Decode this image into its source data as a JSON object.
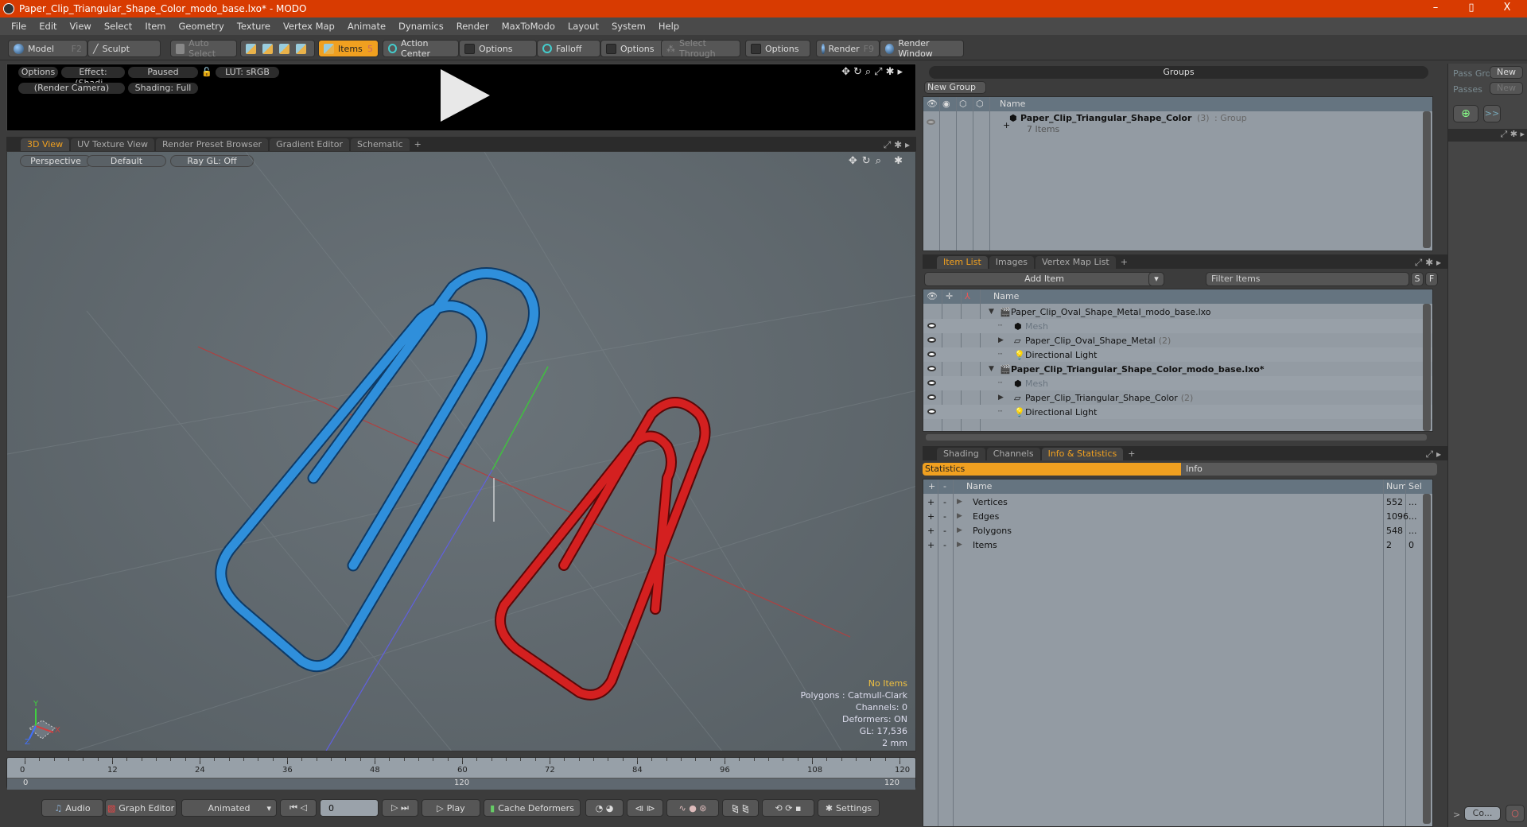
{
  "window": {
    "title": "Paper_Clip_Triangular_Shape_Color_modo_base.lxo* - MODO",
    "controls": [
      "–",
      "▯",
      "X"
    ]
  },
  "menu": [
    "File",
    "Edit",
    "View",
    "Select",
    "Item",
    "Geometry",
    "Texture",
    "Vertex Map",
    "Animate",
    "Dynamics",
    "Render",
    "MaxToModo",
    "Layout",
    "System",
    "Help"
  ],
  "toolbar": {
    "model": "Model",
    "model_key": "F2",
    "sculpt": "Sculpt",
    "auto_select": "Auto Select",
    "items": "Items",
    "items_key": "5",
    "action_center": "Action Center",
    "options1": "Options",
    "falloff": "Falloff",
    "options2": "Options",
    "select_through": "Select Through",
    "options3": "Options",
    "render": "Render",
    "render_key": "F9",
    "render_window": "Render Window"
  },
  "render_preview": {
    "options": "Options",
    "effect": "Effect: (Shadi...",
    "paused": "Paused",
    "lut": "LUT: sRGB",
    "camera": "(Render Camera)",
    "shading": "Shading: Full"
  },
  "view_tabs": [
    "3D View",
    "UV Texture View",
    "Render Preset Browser",
    "Gradient Editor",
    "Schematic",
    "+"
  ],
  "viewport": {
    "perspective": "Perspective",
    "default": "Default",
    "raygl": "Ray GL: Off",
    "axis_labels": {
      "x": "X",
      "y": "Y",
      "z": "Z"
    },
    "overlay": {
      "no_items": "No Items",
      "polygons": "Polygons : Catmull-Clark",
      "channels": "Channels: 0",
      "deformers": "Deformers: ON",
      "gl": "GL: 17,536",
      "scale": "2 mm"
    },
    "colors": {
      "blue_clip": "#2f8fdb",
      "red_clip": "#d42020",
      "accent": "#f0a020"
    }
  },
  "timeline": {
    "ticks": [
      "0",
      "12",
      "24",
      "36",
      "48",
      "60",
      "72",
      "84",
      "96",
      "108",
      "120"
    ],
    "range_start": "0",
    "range_mid": "120",
    "range_end": "120"
  },
  "bottombar": {
    "audio": "Audio",
    "graph_editor": "Graph Editor",
    "animated": "Animated",
    "frame": "0",
    "play": "Play",
    "cache": "Cache Deformers",
    "settings": "Settings"
  },
  "groups": {
    "title": "Groups",
    "new_group": "New Group",
    "col_name": "Name",
    "rows": [
      {
        "name": "Paper_Clip_Triangular_Shape_Color",
        "count": "(3)",
        "type": ": Group",
        "sub": "7 Items"
      }
    ]
  },
  "passes": {
    "pass_groups": "Pass Gro",
    "passes": "Passes",
    "new1": "New",
    "new2": "New",
    "forward": ">>"
  },
  "item_list": {
    "tabs": [
      "Item List",
      "Images",
      "Vertex Map List",
      "+"
    ],
    "add_item": "Add Item",
    "filter_placeholder": "Filter Items",
    "s": "S",
    "f": "F",
    "col_name": "Name",
    "rows": [
      {
        "label": "Paper_Clip_Oval_Shape_Metal_modo_base.lxo",
        "count": "",
        "level": 0,
        "bold": false,
        "dim": false,
        "eye": false
      },
      {
        "label": "Mesh",
        "count": "",
        "level": 1,
        "bold": false,
        "dim": true,
        "eye": true
      },
      {
        "label": "Paper_Clip_Oval_Shape_Metal",
        "count": "(2)",
        "level": 1,
        "bold": false,
        "dim": false,
        "eye": true
      },
      {
        "label": "Directional Light",
        "count": "",
        "level": 1,
        "bold": false,
        "dim": false,
        "eye": true
      },
      {
        "label": "Paper_Clip_Triangular_Shape_Color_modo_base.lxo*",
        "count": "",
        "level": 0,
        "bold": true,
        "dim": false,
        "eye": true
      },
      {
        "label": "Mesh",
        "count": "",
        "level": 1,
        "bold": false,
        "dim": true,
        "eye": true
      },
      {
        "label": "Paper_Clip_Triangular_Shape_Color",
        "count": "(2)",
        "level": 1,
        "bold": false,
        "dim": false,
        "eye": true
      },
      {
        "label": "Directional Light",
        "count": "",
        "level": 1,
        "bold": false,
        "dim": false,
        "eye": true
      }
    ]
  },
  "stats": {
    "tabs": [
      "Shading",
      "Channels",
      "Info & Statistics",
      "+"
    ],
    "subtabs": [
      "Statistics",
      "Info"
    ],
    "cols": [
      "+",
      "-",
      "Name",
      "Num",
      "Sel"
    ],
    "rows": [
      {
        "name": "Vertices",
        "num": "552",
        "sel": "..."
      },
      {
        "name": "Edges",
        "num": "1096",
        "sel": "..."
      },
      {
        "name": "Polygons",
        "num": "548",
        "sel": "..."
      },
      {
        "name": "Items",
        "num": "2",
        "sel": "0"
      }
    ]
  },
  "corner": {
    "co": "Co...",
    "arrow": ">"
  }
}
